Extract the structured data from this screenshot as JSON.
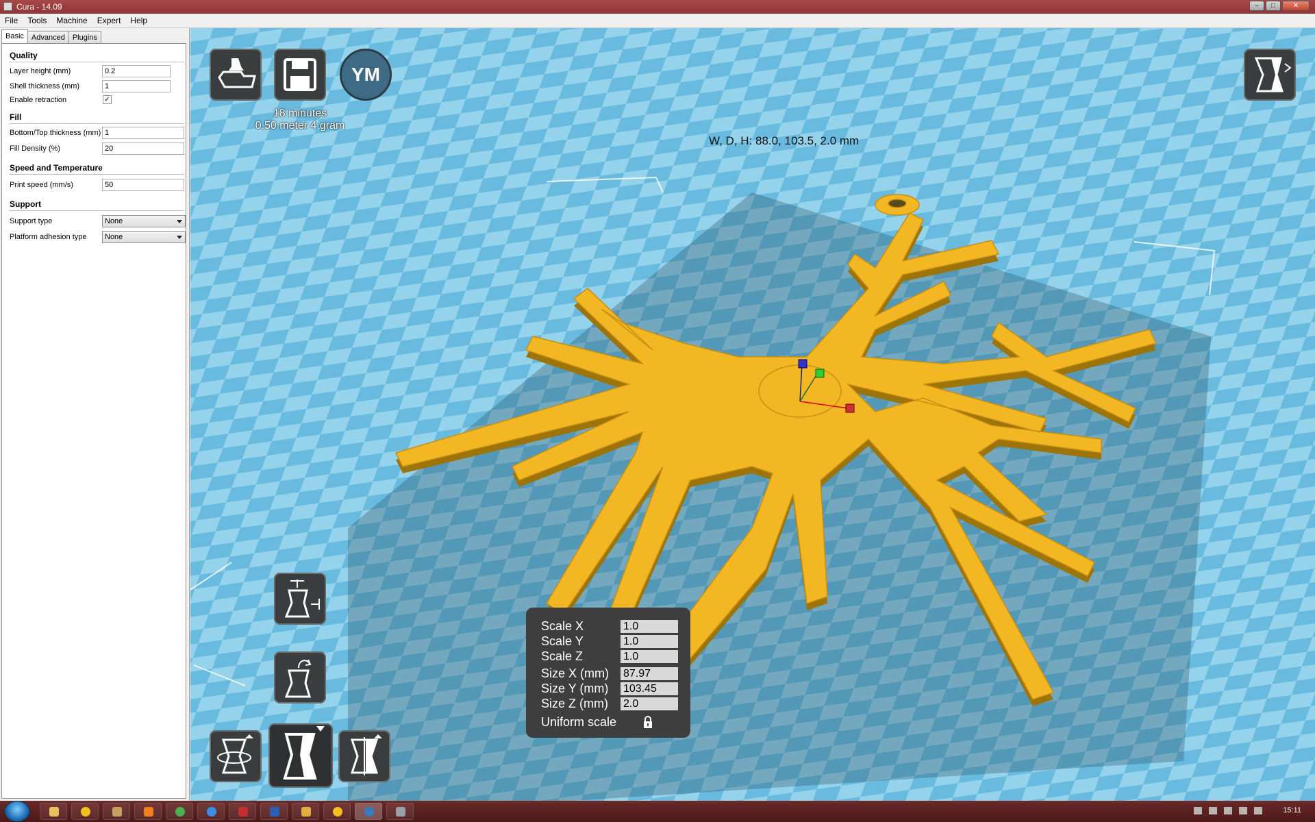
{
  "window": {
    "title": "Cura - 14.09",
    "minimize": "–",
    "maximize": "□",
    "close": "✕"
  },
  "menu": [
    "File",
    "Tools",
    "Machine",
    "Expert",
    "Help"
  ],
  "tabs": [
    "Basic",
    "Advanced",
    "Plugins"
  ],
  "settings": {
    "quality": {
      "title": "Quality",
      "layer_height": {
        "label": "Layer height (mm)",
        "value": "0.2"
      },
      "shell_thickness": {
        "label": "Shell thickness (mm)",
        "value": "1"
      },
      "retraction": {
        "label": "Enable retraction",
        "checked": "✓"
      }
    },
    "fill": {
      "title": "Fill",
      "bottom_top": {
        "label": "Bottom/Top thickness (mm)",
        "value": "1"
      },
      "density": {
        "label": "Fill Density (%)",
        "value": "20"
      }
    },
    "speed": {
      "title": "Speed and Temperature",
      "print_speed": {
        "label": "Print speed (mm/s)",
        "value": "50"
      }
    },
    "support": {
      "title": "Support",
      "support_type": {
        "label": "Support type",
        "value": "None"
      },
      "adhesion": {
        "label": "Platform adhesion type",
        "value": "None"
      }
    }
  },
  "viewport": {
    "print_time": "18 minutes",
    "print_material": "0.50 meter 4 gram",
    "dimensions": "W, D, H: 88.0, 103.5, 2.0 mm",
    "ym_label": "YM",
    "model_color": "#f2b722"
  },
  "scale": {
    "rows": [
      {
        "label": "Scale X",
        "value": "1.0"
      },
      {
        "label": "Scale Y",
        "value": "1.0"
      },
      {
        "label": "Scale Z",
        "value": "1.0"
      },
      {
        "label": "Size X (mm)",
        "value": "87.97"
      },
      {
        "label": "Size Y (mm)",
        "value": "103.45"
      },
      {
        "label": "Size Z (mm)",
        "value": "2.0"
      }
    ],
    "uniform_label": "Uniform scale"
  },
  "taskbar": {
    "clock": "15:11"
  }
}
